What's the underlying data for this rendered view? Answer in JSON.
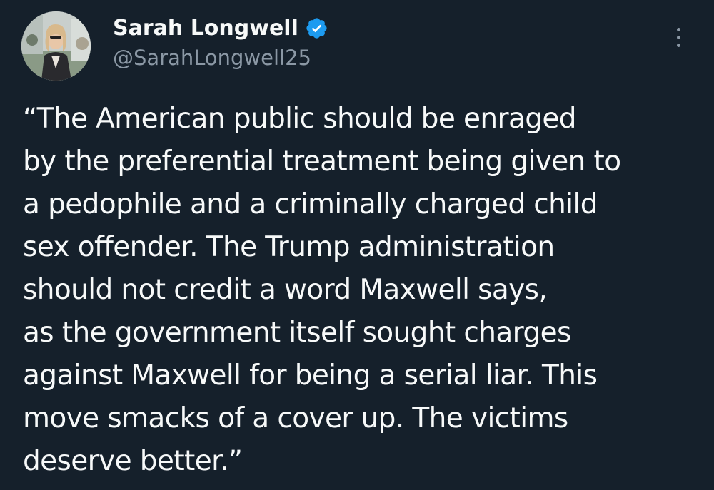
{
  "author": {
    "display_name": "Sarah Longwell",
    "handle": "@SarahLongwell25",
    "verified": true
  },
  "tweet": {
    "lines": [
      "“The American public should be enraged",
      "by the preferential treatment being given to",
      "a pedophile and a criminally charged child",
      "sex offender. The Trump administration",
      "should not credit a word Maxwell says,",
      "as the government itself sought charges",
      "against Maxwell for being a serial liar. This",
      "move smacks of a cover up. The victims",
      "deserve better.”"
    ]
  },
  "icons": {
    "verified": "verified-badge-icon",
    "more": "more-options-icon"
  },
  "colors": {
    "background": "#15202b",
    "text": "#f7f9f9",
    "secondary_text": "#8b98a5",
    "verified_blue": "#1d9bf0"
  }
}
